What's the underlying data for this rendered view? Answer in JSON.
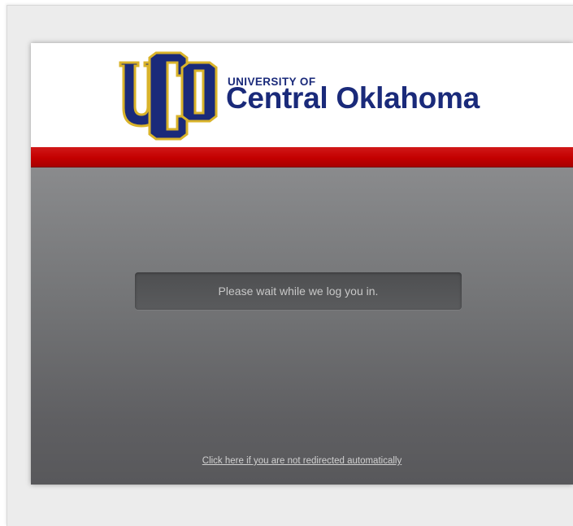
{
  "header": {
    "logo_monogram": "UCO",
    "logo_line1": "UNIVERSITY OF",
    "logo_line2": "Central Oklahoma",
    "brand_navy": "#1a2a7a",
    "brand_gold": "#d9b32a"
  },
  "accent_bar_color": "#c30000",
  "main": {
    "status_message": "Please wait while we log you in.",
    "redirect_link": "Click here if you are not redirected automatically"
  }
}
